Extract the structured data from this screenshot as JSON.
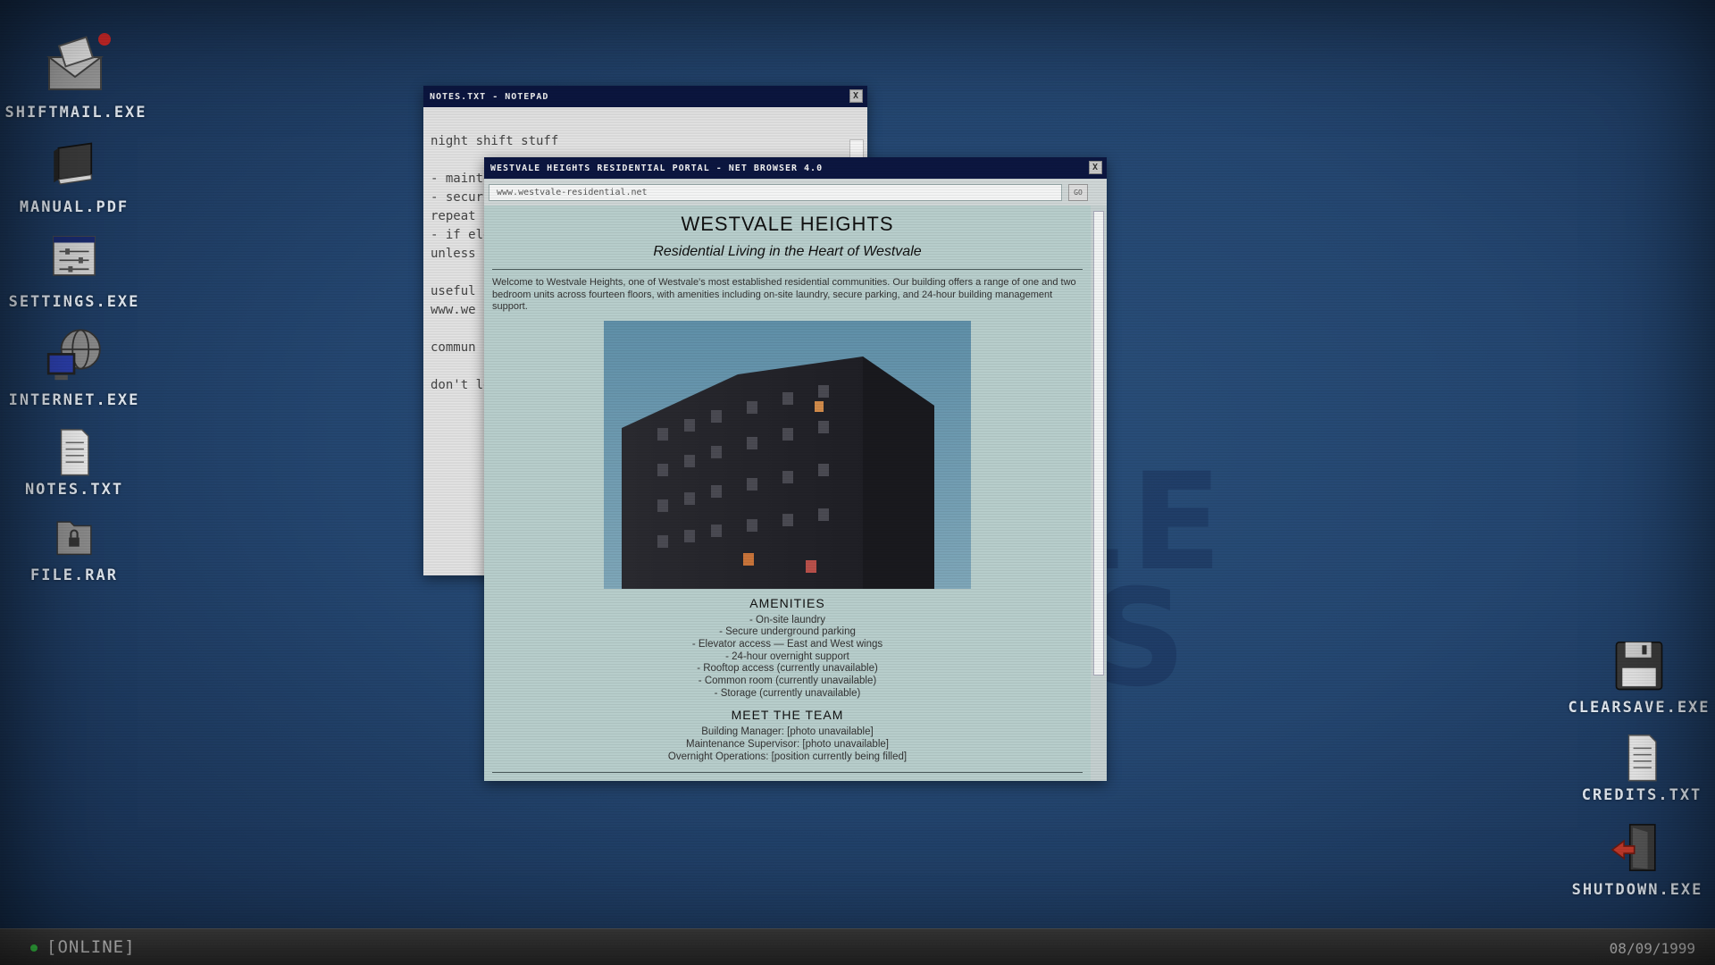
{
  "desktop": {
    "left_icons": [
      {
        "label": "SHIFTMAIL.EXE",
        "icon": "mail-icon"
      },
      {
        "label": "MANUAL.PDF",
        "icon": "book-icon"
      },
      {
        "label": "SETTINGS.EXE",
        "icon": "settings-icon"
      },
      {
        "label": "INTERNET.EXE",
        "icon": "globe-computer-icon"
      },
      {
        "label": "NOTES.TXT",
        "icon": "document-icon"
      },
      {
        "label": "FILE.RAR",
        "icon": "locked-folder-icon"
      }
    ],
    "right_icons": [
      {
        "label": "CLEARSAVE.EXE",
        "icon": "floppy-icon"
      },
      {
        "label": "CREDITS.TXT",
        "icon": "document-icon"
      },
      {
        "label": "SHUTDOWN.EXE",
        "icon": "exit-door-icon"
      }
    ],
    "background_text": [
      "LE",
      "S"
    ]
  },
  "notepad": {
    "title": "NOTES.TXT - NOTEPAD",
    "close": "X",
    "lines": [
      "night shift stuff",
      "",
      "- mainte",
      "- secur",
      "repeat ",
      "- if ele",
      "unless s",
      "",
      "useful s",
      "www.we",
      "",
      "commun",
      "",
      "don't le"
    ]
  },
  "browser": {
    "title": "WESTVALE HEIGHTS RESIDENTIAL PORTAL - NET BROWSER 4.0",
    "close": "X",
    "url": "www.westvale-residential.net",
    "go": "GO",
    "site_title": "WESTVALE HEIGHTS",
    "site_subtitle": "Residential Living in the Heart of Westvale",
    "intro": "Welcome to Westvale Heights, one of Westvale's most established residential communities. Our building offers a range of one and two bedroom units across fourteen floors, with amenities including on-site laundry, secure parking, and 24-hour building management support.",
    "amenities_heading": "AMENITIES",
    "amenities": [
      "- On-site laundry",
      "- Secure underground parking",
      "- Elevator access — East and West wings",
      "- 24-hour overnight support",
      "- Rooftop access (currently unavailable)",
      "- Common room (currently unavailable)",
      "- Storage (currently unavailable)"
    ],
    "team_heading": "MEET THE TEAM",
    "team": [
      "Building Manager: [photo unavailable]",
      "Maintenance Supervisor: [photo unavailable]",
      "Overnight Operations: [position currently being filled]"
    ]
  },
  "taskbar": {
    "status": "[ONLINE]",
    "date": "08/09/1999"
  },
  "colors": {
    "desktop_bg": "#244670",
    "titlebar": "#0c1640",
    "page_bg": "#b7cdcb",
    "status_dot": "#3bd14a",
    "notification_dot": "#d42a2a"
  }
}
